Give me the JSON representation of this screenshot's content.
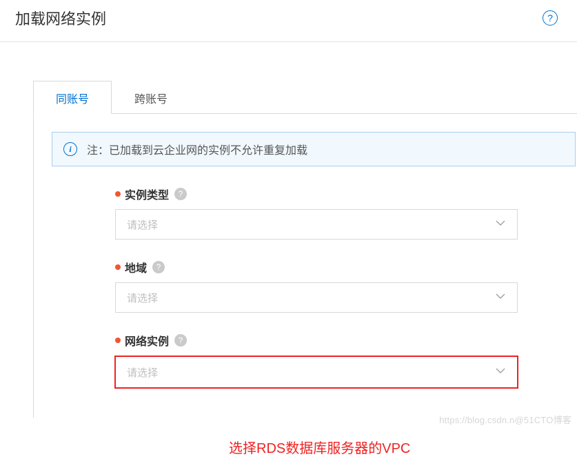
{
  "header": {
    "title": "加载网络实例"
  },
  "tabs": {
    "same_account": "同账号",
    "cross_account": "跨账号"
  },
  "alert": {
    "text": "注：已加载到云企业网的实例不允许重复加载"
  },
  "fields": {
    "instance_type": {
      "label": "实例类型",
      "placeholder": "请选择"
    },
    "region": {
      "label": "地域",
      "placeholder": "请选择"
    },
    "network_instance": {
      "label": "网络实例",
      "placeholder": "请选择"
    }
  },
  "annotation": "选择RDS数据库服务器的VPC",
  "watermark": "https://blog.csdn.n@51CTO博客"
}
